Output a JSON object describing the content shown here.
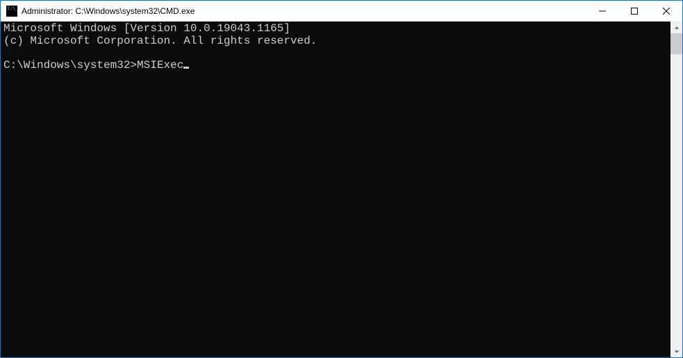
{
  "titlebar": {
    "title": "Administrator: C:\\Windows\\system32\\CMD.exe",
    "icon": "cmd-icon",
    "minimize_label": "Minimize",
    "maximize_label": "Maximize",
    "close_label": "Close"
  },
  "console": {
    "line1": "Microsoft Windows [Version 10.0.19043.1165]",
    "line2": "(c) Microsoft Corporation. All rights reserved.",
    "blank": "",
    "prompt": "C:\\Windows\\system32>",
    "command": "MSIExec"
  }
}
